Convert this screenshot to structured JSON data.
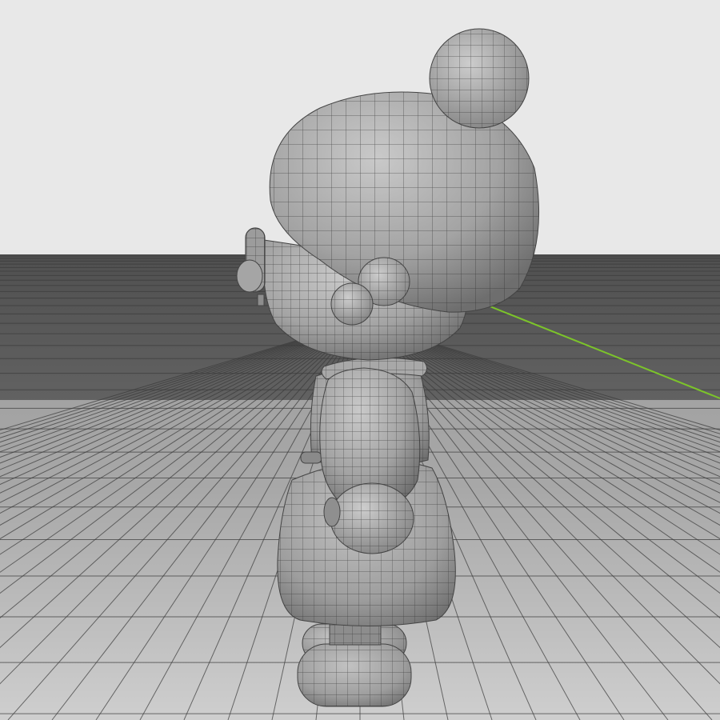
{
  "viewport": {
    "view": "side-orthographic-perspective",
    "background": "#e4e4e4",
    "grid": true,
    "axis_x_color": "#7cc42a",
    "shading": "solid-wireframe"
  },
  "model": {
    "name": "stylized-character",
    "color": "#9a9a9a",
    "wire_color": "#2b2b2b",
    "parts": [
      "head",
      "hair-bun",
      "face",
      "ear",
      "glasses",
      "cheek",
      "body",
      "collar",
      "arm",
      "hand",
      "leg",
      "foot"
    ]
  }
}
